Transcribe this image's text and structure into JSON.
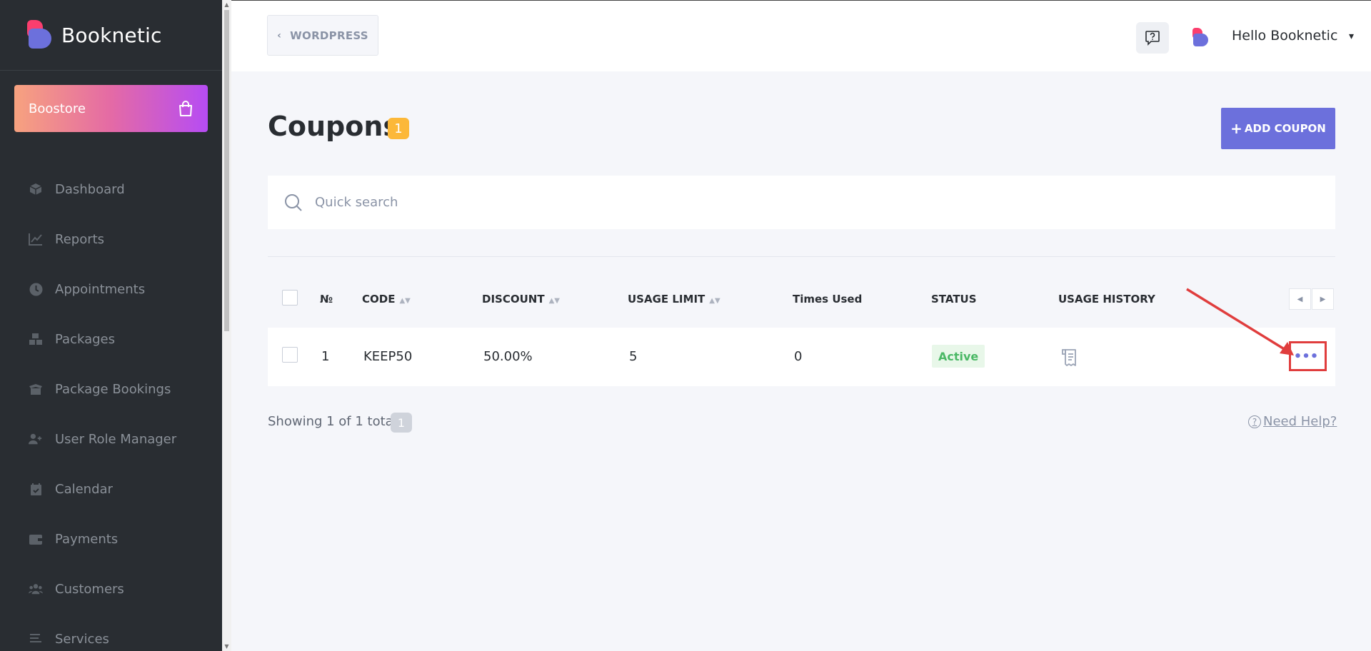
{
  "brand": {
    "name": "Booknetic"
  },
  "boostore": {
    "label": "Boostore"
  },
  "sidebar": {
    "items": [
      {
        "label": "Dashboard",
        "icon": "cube-icon"
      },
      {
        "label": "Reports",
        "icon": "chart-line-icon"
      },
      {
        "label": "Appointments",
        "icon": "clock-icon"
      },
      {
        "label": "Packages",
        "icon": "boxes-icon"
      },
      {
        "label": "Package Bookings",
        "icon": "box-open-icon"
      },
      {
        "label": "User Role Manager",
        "icon": "user-plus-icon"
      },
      {
        "label": "Calendar",
        "icon": "calendar-check-icon"
      },
      {
        "label": "Payments",
        "icon": "wallet-icon"
      },
      {
        "label": "Customers",
        "icon": "users-icon"
      },
      {
        "label": "Services",
        "icon": "list-icon"
      }
    ]
  },
  "topbar": {
    "back_label": "WORDPRESS",
    "user_greeting": "Hello Booknetic"
  },
  "page": {
    "title": "Coupons",
    "count": "1",
    "add_button": "ADD COUPON"
  },
  "search": {
    "placeholder": "Quick search"
  },
  "table": {
    "headers": {
      "num": "№",
      "code": "CODE",
      "discount": "DISCOUNT",
      "usage_limit": "USAGE LIMIT",
      "times_used": "Times Used",
      "status": "STATUS",
      "usage_history": "USAGE HISTORY"
    },
    "rows": [
      {
        "num": "1",
        "code": "KEEP50",
        "discount": "50.00%",
        "usage_limit": "5",
        "times_used": "0",
        "status": "Active"
      }
    ]
  },
  "footer": {
    "showing": "Showing 1 of 1 total",
    "page": "1",
    "need_help": "Need Help?"
  },
  "colors": {
    "sidebar_bg": "#292d32",
    "accent": "#6c70dc",
    "brand_pink": "#fb3e6e",
    "badge_yellow": "#fcb839",
    "status_green": "#4ab865",
    "annotation_red": "#e03d3d"
  }
}
